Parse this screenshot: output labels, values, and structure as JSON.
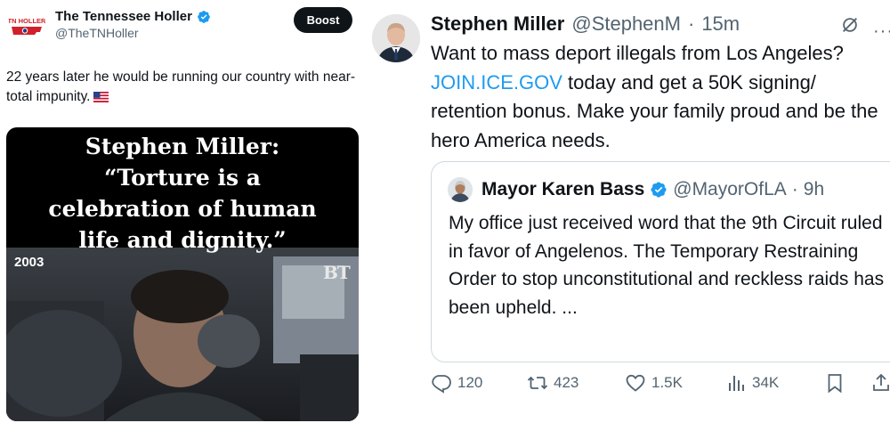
{
  "left_post": {
    "author_name": "The Tennessee Holler",
    "author_handle": "@TheTNHoller",
    "avatar_logo_text": "TN HOLLER",
    "boost_label": "Boost",
    "text": "22 years later he would be running our country with near-total impunity.",
    "text_emoji": "🇺🇸",
    "video": {
      "caption": "Stephen Miller:\n“Torture is a\ncelebration of human\nlife and dignity.”",
      "year_label": "2003",
      "watermark": "BT"
    }
  },
  "right_post": {
    "author_name": "Stephen Miller",
    "author_handle": "@StephenM",
    "separator": "·",
    "time": "15m",
    "text_before_link": "Want to mass deport illegals from Los Angeles? ",
    "link_text": "JOIN.ICE.GOV",
    "text_after_link": " today and get a 50K signing/ retention bonus. Make your family proud and be the hero America needs.",
    "quoted": {
      "author_name": "Mayor Karen Bass",
      "author_handle": "@MayorOfLA",
      "separator": "·",
      "time": "9h",
      "text": "My office just received word that the 9th Circuit ruled in favor of Angelenos. The Temporary Restraining Order to stop unconstitutional and reckless raids has been upheld. ..."
    },
    "actions": {
      "replies": "120",
      "reposts": "423",
      "likes": "1.5K",
      "views": "34K"
    }
  },
  "colors": {
    "link": "#1d9bf0",
    "verified": "#1d9bf0",
    "secondary_text": "#536471",
    "boost_bg": "#0f1419"
  }
}
